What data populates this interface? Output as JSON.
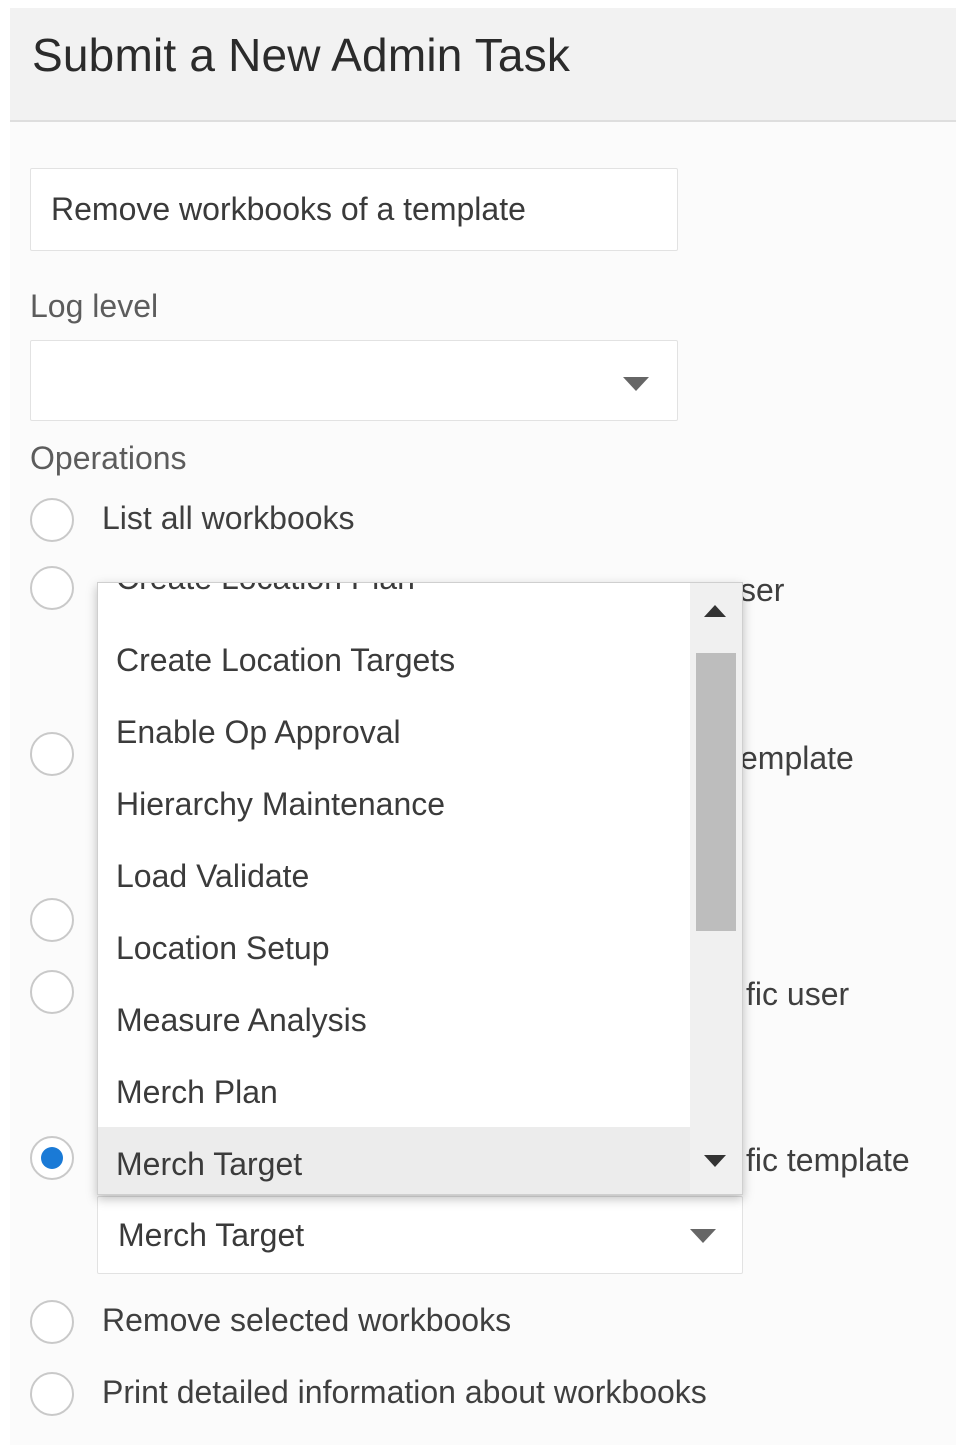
{
  "header": {
    "title": "Submit a New Admin Task"
  },
  "task_field": {
    "value": "Remove workbooks of a template"
  },
  "log_level": {
    "label": "Log level",
    "value": ""
  },
  "operations": {
    "label": "Operations",
    "options": [
      {
        "label": "List all workbooks",
        "selected": false
      },
      {
        "label": "Create Location Plan … specific user",
        "visible_fragment": "ser",
        "selected": false
      },
      {
        "label": "…template",
        "visible_fragment": "emplate",
        "selected": false
      },
      {
        "label": "",
        "visible_fragment": "",
        "selected": false
      },
      {
        "label": "…specific user",
        "visible_fragment": "fic user",
        "selected": false
      },
      {
        "label": "…specific template",
        "visible_fragment": "fic template",
        "selected": true
      },
      {
        "label": "Remove selected workbooks",
        "selected": false
      },
      {
        "label": "Print detailed information about workbooks",
        "selected": false
      }
    ]
  },
  "template_select": {
    "value": "Merch Target"
  },
  "dropdown": {
    "items": [
      "Create Location Plan",
      "Create Location Targets",
      "Enable Op Approval",
      "Hierarchy Maintenance",
      "Load Validate",
      "Location Setup",
      "Measure Analysis",
      "Merch Plan",
      "Merch Target"
    ],
    "highlighted": "Merch Target"
  },
  "colors": {
    "accent": "#1a7ad6",
    "header_bg": "#f2f2f2",
    "panel_bg": "#fbfbfb"
  }
}
